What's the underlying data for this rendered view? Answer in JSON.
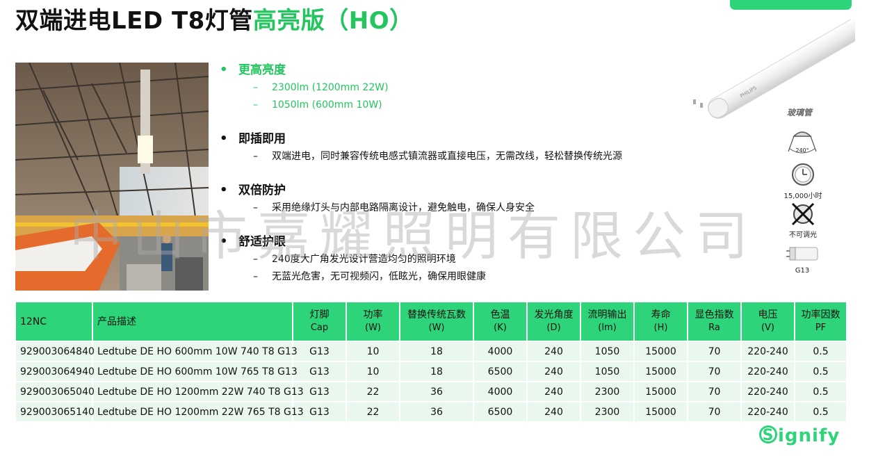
{
  "title": {
    "black": "双端进电LED T8灯管",
    "green": "高亮版（HO）"
  },
  "features": [
    {
      "title": "更高亮度",
      "green": true,
      "items": [
        "2300lm (1200mm 22W)",
        "1050lm (600mm 10W)"
      ]
    },
    {
      "title": "即插即用",
      "green": false,
      "items": [
        "双端进电，同时兼容传统电感式镇流器或直接电压，无需改线，轻松替换传统光源"
      ]
    },
    {
      "title": "双倍防护",
      "green": false,
      "items": [
        "采用绝缘灯头与内部电路隔离设计，避免触电，确保人身安全"
      ]
    },
    {
      "title": "舒适护眼",
      "green": false,
      "items": [
        "240度大广角发光设计营造均匀的照明环境",
        "无蓝光危害，无可视频闪，低眩光，确保用眼健康"
      ]
    }
  ],
  "product_image": {
    "brand": "PHILIPS",
    "material_label": "玻璃管"
  },
  "icons": [
    {
      "name": "beam-angle-icon",
      "label": "240°",
      "caption": ""
    },
    {
      "name": "clock-icon",
      "label": "",
      "caption": "15,000小时"
    },
    {
      "name": "no-dimming-icon",
      "label": "",
      "caption": "不可调光"
    },
    {
      "name": "g13-cap-icon",
      "label": "",
      "caption": "G13"
    }
  ],
  "watermark": "中山市嘉耀照明有限公司",
  "table": {
    "headers": [
      {
        "main": "12NC",
        "unit": ""
      },
      {
        "main": "产品描述",
        "unit": ""
      },
      {
        "main": "灯脚",
        "unit": "Cap"
      },
      {
        "main": "功率",
        "unit": "(W)"
      },
      {
        "main": "替换传统瓦数",
        "unit": "(W)"
      },
      {
        "main": "色温",
        "unit": "(K)"
      },
      {
        "main": "发光角度",
        "unit": "(D)"
      },
      {
        "main": "流明输出",
        "unit": "(lm)"
      },
      {
        "main": "寿命",
        "unit": "(H)"
      },
      {
        "main": "显色指数",
        "unit": "Ra"
      },
      {
        "main": "电压",
        "unit": "(V)"
      },
      {
        "main": "功率因数",
        "unit": "PF"
      }
    ],
    "rows": [
      [
        "929003064840",
        "Ledtube DE HO 600mm 10W 740 T8 G13",
        "G13",
        "10",
        "18",
        "4000",
        "240",
        "1050",
        "15000",
        "70",
        "220-240",
        "0.5"
      ],
      [
        "929003064940",
        "Ledtube DE HO 600mm 10W 765 T8 G13",
        "G13",
        "10",
        "18",
        "6500",
        "240",
        "1050",
        "15000",
        "70",
        "220-240",
        "0.5"
      ],
      [
        "929003065040",
        "Ledtube DE HO 1200mm 22W 740 T8 G13",
        "G13",
        "22",
        "36",
        "4000",
        "240",
        "2300",
        "15000",
        "70",
        "220-240",
        "0.5"
      ],
      [
        "929003065140",
        "Ledtube DE HO 1200mm 22W 765 T8 G13",
        "G13",
        "22",
        "36",
        "6500",
        "240",
        "2300",
        "15000",
        "70",
        "220-240",
        "0.5"
      ]
    ]
  },
  "logo": {
    "text": "ignify",
    "mark": "S"
  },
  "colors": {
    "accent": "#2dd47a",
    "accent_text": "#22c55e",
    "row_bg": "#e9f7ee"
  }
}
